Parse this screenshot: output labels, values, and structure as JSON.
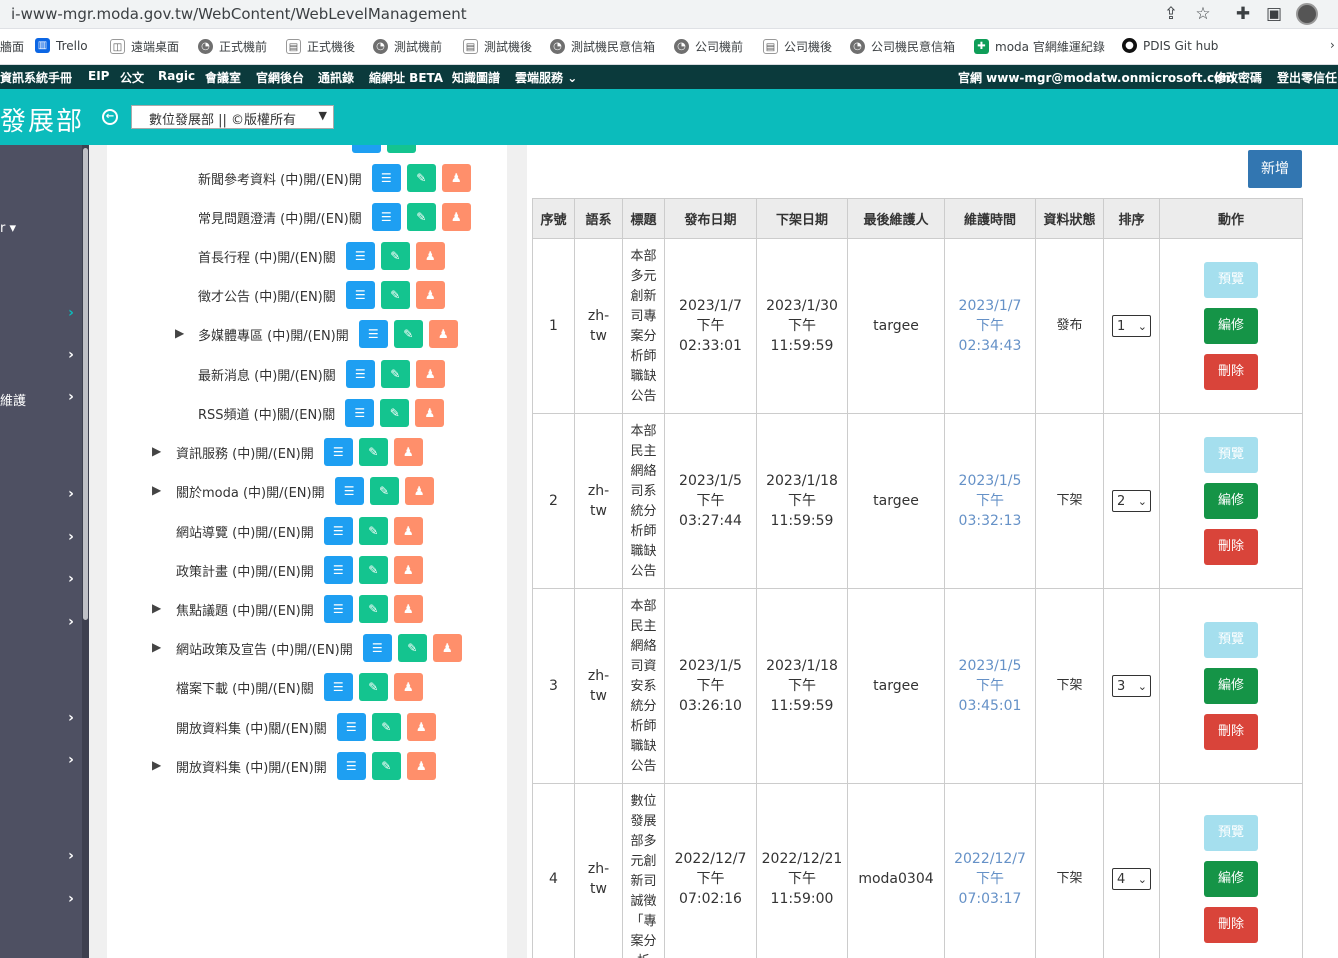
{
  "browser": {
    "url": "i-www-mgr.moda.gov.tw/WebContent/WebLevelManagement",
    "bookmarks": [
      "牆面",
      "Trello",
      "遠端桌面",
      "正式機前",
      "正式機後",
      "測試機前",
      "測試機後",
      "測試機民意信箱",
      "公司機前",
      "公司機後",
      "公司機民意信箱",
      "moda 官網維運紀錄",
      "PDIS Git hub"
    ]
  },
  "topnav": {
    "left": [
      "資訊系統手冊",
      "EIP",
      "公文",
      "Ragic",
      "會議室",
      "官網後台",
      "通訊錄",
      "縮網址 BETA",
      "知識圖譜",
      "雲端服務"
    ],
    "right": [
      "官網 www-mgr@modatw.onmicrosoft.com",
      "修改密碼",
      "登出零信任"
    ]
  },
  "header": {
    "brand": "發展部",
    "site_select": "數位發展部 || ©版權所有"
  },
  "sidebar": {
    "partial_items": [
      "r",
      "維護"
    ]
  },
  "tree": [
    {
      "label": "新聞參考資料 (中)開/(EN)開",
      "expandable": false
    },
    {
      "label": "常見問題澄清 (中)開/(EN)關",
      "expandable": false
    },
    {
      "label": "首長行程 (中)開/(EN)關",
      "expandable": false
    },
    {
      "label": "徵才公告 (中)開/(EN)關",
      "expandable": false
    },
    {
      "label": "多媒體專區 (中)開/(EN)開",
      "expandable": true
    },
    {
      "label": "最新消息 (中)開/(EN)關",
      "expandable": false
    },
    {
      "label": "RSS頻道 (中)關/(EN)關",
      "expandable": false
    },
    {
      "label": "資訊服務 (中)開/(EN)開",
      "expandable": true
    },
    {
      "label": "關於moda (中)開/(EN)開",
      "expandable": true
    },
    {
      "label": "網站導覽 (中)開/(EN)開",
      "expandable": false
    },
    {
      "label": "政策計畫 (中)開/(EN)開",
      "expandable": false
    },
    {
      "label": "焦點議題 (中)開/(EN)開",
      "expandable": true
    },
    {
      "label": "網站政策及宣告 (中)開/(EN)開",
      "expandable": true
    },
    {
      "label": "檔案下載 (中)開/(EN)關",
      "expandable": false
    },
    {
      "label": "開放資料集 (中)關/(EN)關",
      "expandable": false
    },
    {
      "label": "開放資料集 (中)開/(EN)開",
      "expandable": true
    }
  ],
  "table": {
    "add_label": "新增",
    "headers": [
      "序號",
      "語系",
      "標題",
      "發布日期",
      "下架日期",
      "最後維護人",
      "維護時間",
      "資料狀態",
      "排序",
      "動作"
    ],
    "actions": {
      "preview": "預覽",
      "edit": "編修",
      "delete": "刪除"
    },
    "rows": [
      {
        "no": "1",
        "lang": "zh-tw",
        "title": "本部多元創新司專案分析師職缺公告",
        "publish": [
          "2023/1/7",
          "下午",
          "02:33:01"
        ],
        "unpublish": [
          "2023/1/30",
          "下午",
          "11:59:59"
        ],
        "maintainer": "targee",
        "maint_time": [
          "2023/1/7",
          "下午",
          "02:34:43"
        ],
        "status": "發布",
        "order": "1"
      },
      {
        "no": "2",
        "lang": "zh-tw",
        "title": "本部民主網絡司系統分析師職缺公告",
        "publish": [
          "2023/1/5",
          "下午",
          "03:27:44"
        ],
        "unpublish": [
          "2023/1/18",
          "下午",
          "11:59:59"
        ],
        "maintainer": "targee",
        "maint_time": [
          "2023/1/5",
          "下午",
          "03:32:13"
        ],
        "status": "下架",
        "order": "2"
      },
      {
        "no": "3",
        "lang": "zh-tw",
        "title": "本部民主網絡司資安系統分析師職缺公告",
        "publish": [
          "2023/1/5",
          "下午",
          "03:26:10"
        ],
        "unpublish": [
          "2023/1/18",
          "下午",
          "11:59:59"
        ],
        "maintainer": "targee",
        "maint_time": [
          "2023/1/5",
          "下午",
          "03:45:01"
        ],
        "status": "下架",
        "order": "3"
      },
      {
        "no": "4",
        "lang": "zh-tw",
        "title": "數位發展部多元創新司誠徵「專案分析",
        "publish": [
          "2022/12/7",
          "下午",
          "07:02:16"
        ],
        "unpublish": [
          "2022/12/21",
          "下午",
          "11:59:00"
        ],
        "maintainer": "moda0304",
        "maint_time": [
          "2022/12/7",
          "下午",
          "07:03:17"
        ],
        "status": "下架",
        "order": "4"
      }
    ]
  },
  "colors": {
    "header": "#0bbcbc",
    "topnav": "#0b3a3c",
    "sidebar": "#4e5062",
    "list_btn": "#1e9ff2",
    "edit_btn": "#14c48f",
    "user_btn": "#ff8f6b"
  }
}
